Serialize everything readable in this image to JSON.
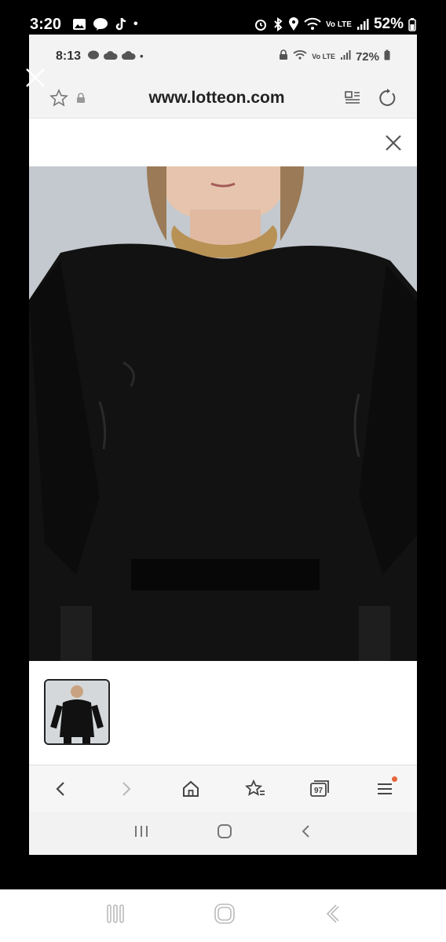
{
  "outer_status": {
    "time": "3:20",
    "battery": "52%",
    "signal_text": "Vo LTE"
  },
  "inner_status": {
    "time": "8:13",
    "battery": "72%",
    "signal_text": "Vo LTE"
  },
  "browser": {
    "url": "www.lotteon.com",
    "tab_count": "97"
  },
  "colors": {
    "accent_dot": "#e8663d",
    "frame": "#000000",
    "page_bg": "#ffffff"
  }
}
